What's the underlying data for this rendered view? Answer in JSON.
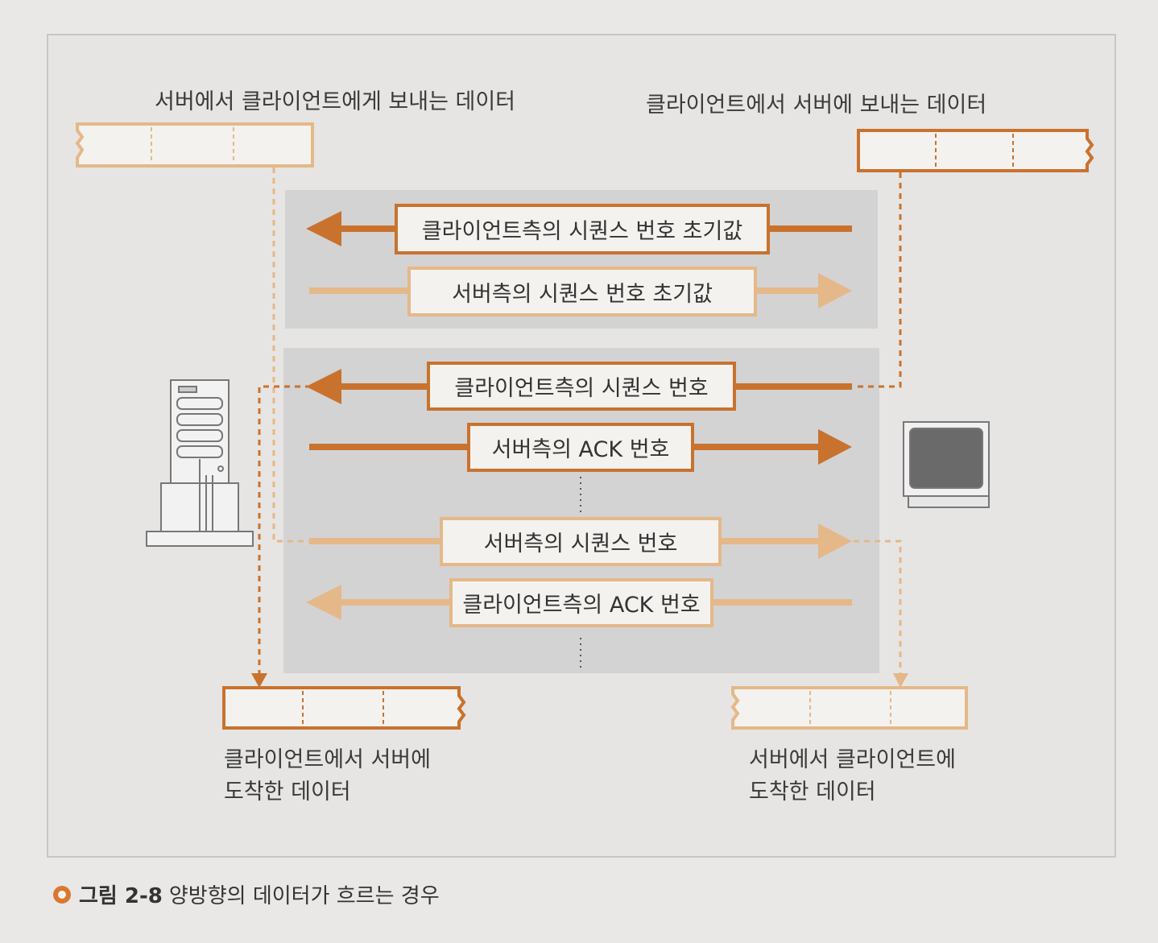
{
  "labels": {
    "top_left": "서버에서 클라이언트에게 보내는 데이터",
    "top_right": "클라이언트에서 서버에 보내는 데이터",
    "bottom_left_line1": "클라이언트에서  서버에",
    "bottom_left_line2": "도착한 데이터",
    "bottom_right_line1": "서버에서  클라이언트에",
    "bottom_right_line2": "도착한 데이터"
  },
  "arrows": {
    "a1": "클라이언트측의 시퀀스 번호 초기값",
    "a2": "서버측의 시퀀스 번호 초기값",
    "a3": "클라이언트측의 시퀀스 번호",
    "a4": "서버측의 ACK 번호",
    "a5": "서버측의 시퀀스 번호",
    "a6": "클라이언트측의 ACK 번호"
  },
  "caption": {
    "figure": "그림 2-8",
    "text": "양방향의 데이터가 흐르는 경우"
  },
  "colors": {
    "dark_orange": "#c9722e",
    "light_orange": "#e5b889",
    "panel": "#d3d3d3"
  },
  "icons": [
    "server-icon",
    "monitor-icon"
  ]
}
